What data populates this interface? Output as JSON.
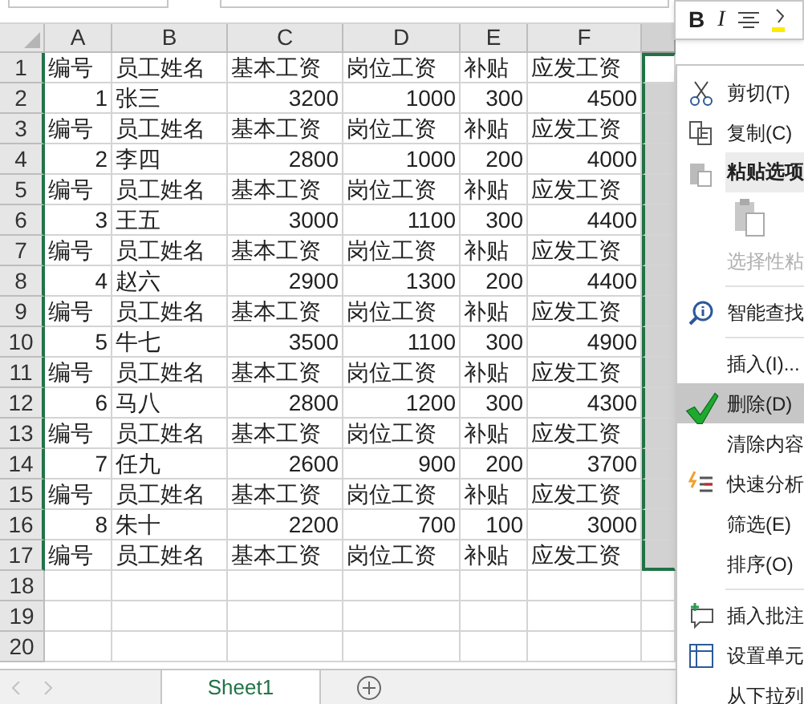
{
  "mini_toolbar": {
    "buttons": [
      {
        "label": "B",
        "kind": "bold"
      },
      {
        "label": "I",
        "kind": "italic"
      },
      {
        "kind": "align"
      },
      {
        "kind": "highlight"
      }
    ]
  },
  "columns": [
    {
      "label": "A",
      "selected": false
    },
    {
      "label": "B",
      "selected": false
    },
    {
      "label": "C",
      "selected": false
    },
    {
      "label": "D",
      "selected": false
    },
    {
      "label": "E",
      "selected": false
    },
    {
      "label": "F",
      "selected": false
    },
    {
      "selected": true
    }
  ],
  "rows": [
    {
      "number": "1",
      "kind": "header",
      "cells": [
        "编号",
        "员工姓名",
        "基本工资",
        "岗位工资",
        "补贴",
        "应发工资"
      ]
    },
    {
      "number": "2",
      "kind": "record",
      "cells": [
        "1",
        "张三",
        "3200",
        "1000",
        "300",
        "4500"
      ]
    },
    {
      "number": "3",
      "kind": "header",
      "cells": [
        "编号",
        "员工姓名",
        "基本工资",
        "岗位工资",
        "补贴",
        "应发工资"
      ]
    },
    {
      "number": "4",
      "kind": "record",
      "cells": [
        "2",
        "李四",
        "2800",
        "1000",
        "200",
        "4000"
      ]
    },
    {
      "number": "5",
      "kind": "header",
      "cells": [
        "编号",
        "员工姓名",
        "基本工资",
        "岗位工资",
        "补贴",
        "应发工资"
      ]
    },
    {
      "number": "6",
      "kind": "record",
      "cells": [
        "3",
        "王五",
        "3000",
        "1100",
        "300",
        "4400"
      ]
    },
    {
      "number": "7",
      "kind": "header",
      "cells": [
        "编号",
        "员工姓名",
        "基本工资",
        "岗位工资",
        "补贴",
        "应发工资"
      ]
    },
    {
      "number": "8",
      "kind": "record",
      "cells": [
        "4",
        "赵六",
        "2900",
        "1300",
        "200",
        "4400"
      ]
    },
    {
      "number": "9",
      "kind": "header",
      "cells": [
        "编号",
        "员工姓名",
        "基本工资",
        "岗位工资",
        "补贴",
        "应发工资"
      ]
    },
    {
      "number": "10",
      "kind": "record",
      "cells": [
        "5",
        "牛七",
        "3500",
        "1100",
        "300",
        "4900"
      ]
    },
    {
      "number": "11",
      "kind": "header",
      "cells": [
        "编号",
        "员工姓名",
        "基本工资",
        "岗位工资",
        "补贴",
        "应发工资"
      ]
    },
    {
      "number": "12",
      "kind": "record",
      "cells": [
        "6",
        "马八",
        "2800",
        "1200",
        "300",
        "4300"
      ]
    },
    {
      "number": "13",
      "kind": "header",
      "cells": [
        "编号",
        "员工姓名",
        "基本工资",
        "岗位工资",
        "补贴",
        "应发工资"
      ]
    },
    {
      "number": "14",
      "kind": "record",
      "cells": [
        "7",
        "任九",
        "2600",
        "900",
        "200",
        "3700"
      ]
    },
    {
      "number": "15",
      "kind": "header",
      "cells": [
        "编号",
        "员工姓名",
        "基本工资",
        "岗位工资",
        "补贴",
        "应发工资"
      ]
    },
    {
      "number": "16",
      "kind": "record",
      "cells": [
        "8",
        "朱十",
        "2200",
        "700",
        "100",
        "3000"
      ]
    },
    {
      "number": "17",
      "kind": "header",
      "cells": [
        "编号",
        "员工姓名",
        "基本工资",
        "岗位工资",
        "补贴",
        "应发工资"
      ]
    },
    {
      "number": "18",
      "kind": "empty"
    },
    {
      "number": "19",
      "kind": "empty"
    },
    {
      "number": "20",
      "kind": "empty"
    }
  ],
  "context_menu": [
    {
      "kind": "cut",
      "label": "剪切(T)",
      "disabled": false,
      "selected": false
    },
    {
      "kind": "copy",
      "label": "复制(C)",
      "disabled": false,
      "selected": false
    },
    {
      "kind": "header",
      "label": "粘贴选项"
    },
    {
      "kind": "paste_option"
    },
    {
      "kind": "plain",
      "label": "选择性粘",
      "disabled": true,
      "selected": false
    },
    {
      "kind": "separator"
    },
    {
      "kind": "smart_lookup",
      "label": "智能查找",
      "disabled": false,
      "selected": false
    },
    {
      "kind": "separator"
    },
    {
      "kind": "plain",
      "label": "插入(I)...",
      "disabled": false,
      "selected": false
    },
    {
      "kind": "plain",
      "label": "删除(D)",
      "disabled": false,
      "selected": true
    },
    {
      "kind": "plain",
      "label": "清除内容",
      "disabled": false,
      "selected": false
    },
    {
      "kind": "quick_analysis",
      "label": "快速分析",
      "disabled": false,
      "selected": false
    },
    {
      "kind": "plain",
      "label": "筛选(E)",
      "disabled": false,
      "selected": false
    },
    {
      "kind": "plain",
      "label": "排序(O)",
      "disabled": false,
      "selected": false
    },
    {
      "kind": "separator"
    },
    {
      "kind": "comment",
      "label": "插入批注",
      "disabled": false,
      "selected": false
    },
    {
      "kind": "format_cells",
      "label": "设置单元",
      "disabled": false,
      "selected": false
    },
    {
      "kind": "plain",
      "label": "从下拉列",
      "disabled": false,
      "selected": false
    }
  ],
  "sheet_tabs": [
    {
      "label": "Sheet1",
      "selected": true
    }
  ]
}
